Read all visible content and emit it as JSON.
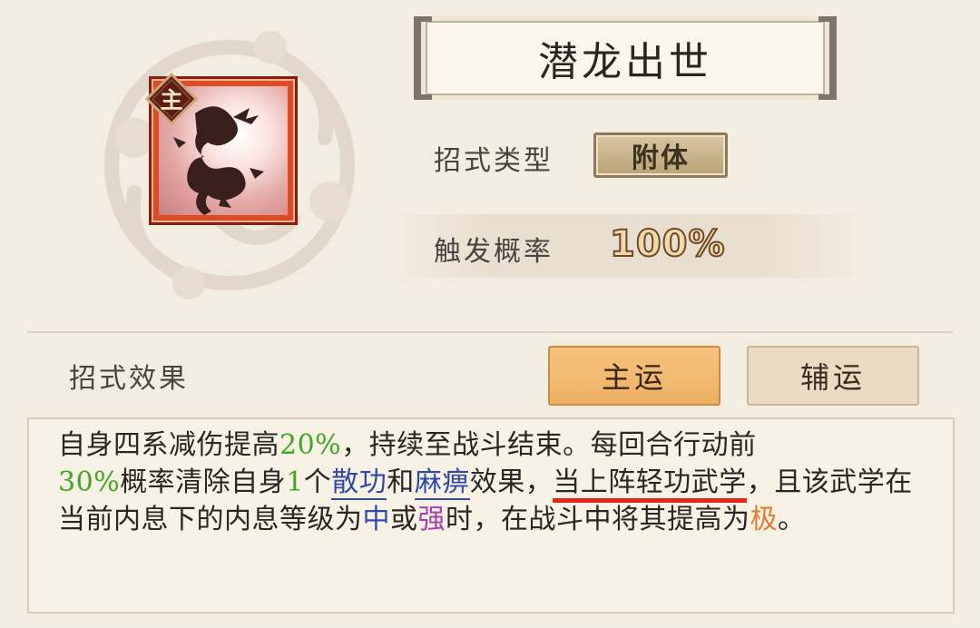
{
  "skill": {
    "name": "潜龙出世",
    "badge": "主",
    "type_label": "招式类型",
    "type_value": "附体",
    "prob_label": "触发概率",
    "prob_value": "100%"
  },
  "effect": {
    "section_label": "招式效果",
    "tab_main": "主运",
    "tab_aux": "辅运",
    "text": {
      "p1": "自身四系减伤提高",
      "v1": "20%",
      "p2": "，持续至战斗结束。每回合行动前",
      "v2": "30%",
      "p3": "概率清除自身",
      "v3": "1",
      "p4": "个",
      "k1": "散功",
      "p5": "和",
      "k2": "麻痹",
      "p6": "效果，",
      "k3": "当上阵轻功武学",
      "p7": "，且该武学在当前内息下的内息等级为",
      "k4": "中",
      "p8": "或",
      "k5": "强",
      "p9": "时，在战斗中将其提高为",
      "k6": "极",
      "p10": "。"
    }
  },
  "colors": {
    "background": "#f3ece0",
    "accent_orange": "#eeb165",
    "highlight_green": "#3ea823",
    "highlight_blue": "#2f4ba8",
    "highlight_purple": "#a83fb0",
    "highlight_orange": "#e27b2d",
    "annotation_red": "#e0291b"
  },
  "icons": {
    "skill_icon": "dragon-icon",
    "badge_icon": "diamond-badge-icon",
    "emblem": "cloud-emblem"
  }
}
